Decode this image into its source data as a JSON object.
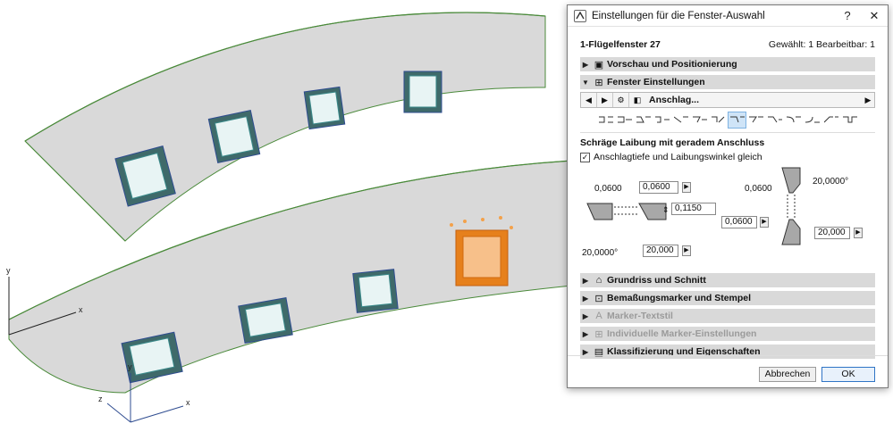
{
  "viewport": {
    "axes1": {
      "y": "y",
      "x": "x"
    },
    "axes2": {
      "y": "y",
      "x": "x",
      "z": "z"
    }
  },
  "dialog": {
    "title": "Einstellungen für die Fenster-Auswahl",
    "help": "?",
    "close": "✕",
    "element_name": "1-Flügelfenster 27",
    "selection_info": "Gewählt: 1 Bearbeitbar: 1",
    "sections_top": [
      {
        "label": "Vorschau und Positionierung",
        "expanded": false
      },
      {
        "label": "Fenster Einstellungen",
        "expanded": true
      }
    ],
    "toolbar": {
      "label": "Anschlag...",
      "prev": "◀",
      "next": "▶",
      "end": "▶"
    },
    "subtitle": "Schräge Laibung mit geradem Anschluss",
    "checkbox": {
      "label": "Anschlagtiefe und Laibungswinkel gleich",
      "checked": "✓"
    },
    "params": {
      "top_left_value": "0,0600",
      "top_left_field": "0,0600",
      "depth_field": "0,1150",
      "angle_left_value": "20,0000°",
      "angle_left_field": "20,000",
      "right_top_value": "0,0600",
      "right_angle_value": "20,0000°",
      "right_bottom_field": "0,0600",
      "right_angle_field": "20,000"
    },
    "sections_bottom": [
      {
        "label": "Grundriss und Schnitt",
        "disabled": false
      },
      {
        "label": "Bemaßungsmarker und Stempel",
        "disabled": false
      },
      {
        "label": "Marker-Textstil",
        "disabled": true
      },
      {
        "label": "Individuelle Marker-Einstellungen",
        "disabled": true
      },
      {
        "label": "Klassifizierung und Eigenschaften",
        "disabled": false
      }
    ],
    "cancel": "Abbrechen",
    "ok": "OK"
  }
}
